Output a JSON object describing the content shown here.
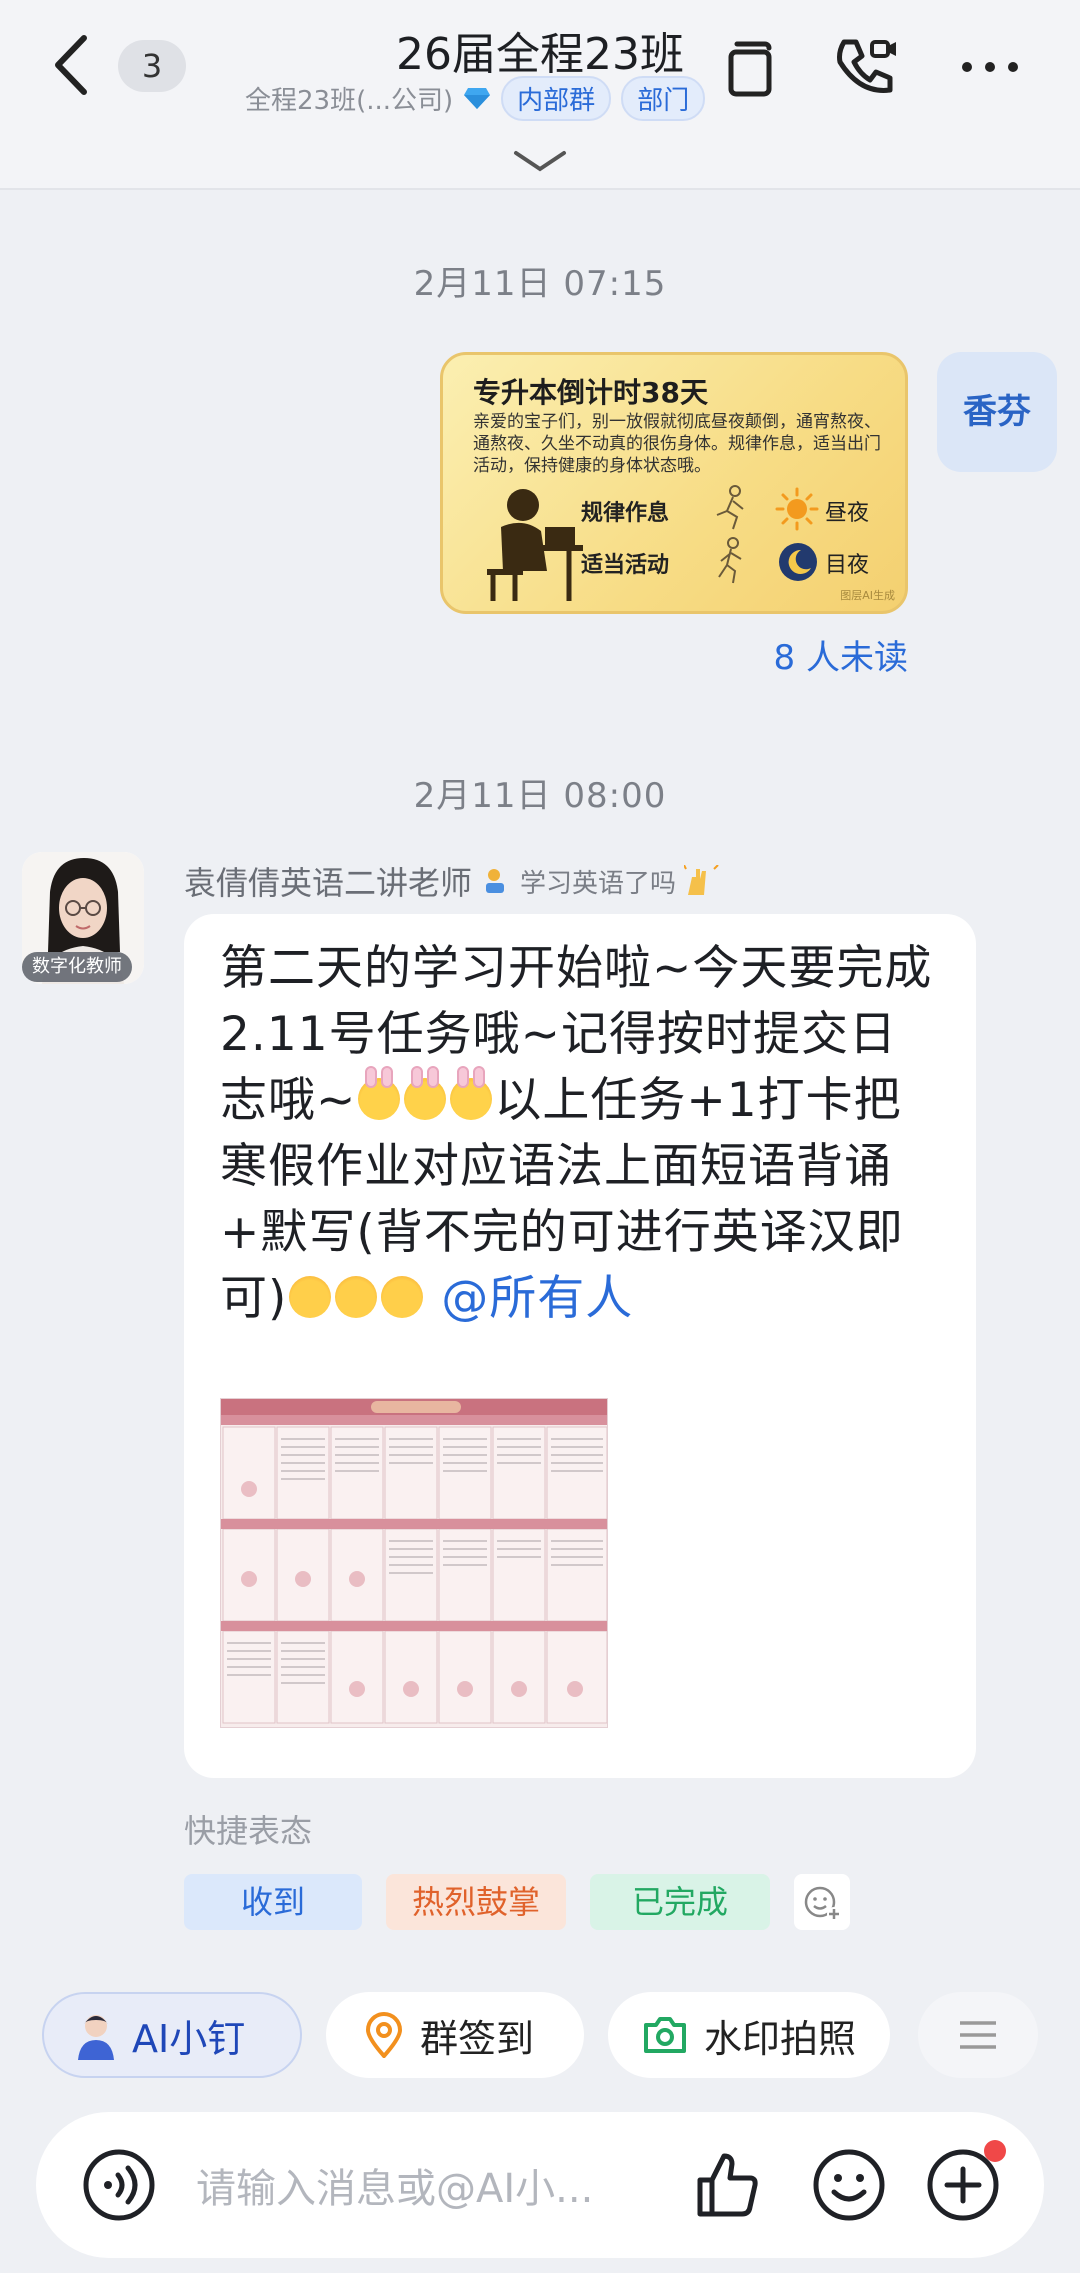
{
  "header": {
    "back_icon": "chevron-left-icon",
    "unread_count": "3",
    "title": "26届全程23班",
    "subtitle": "全程23班(...公司)",
    "tags": [
      "内部群",
      "部门"
    ],
    "icons": [
      "copy-icon",
      "video-call-icon",
      "more-icon",
      "chevron-down-icon"
    ]
  },
  "messages": [
    {
      "time": "2月11日 07:15",
      "sender": "香芬",
      "card": {
        "title": "专升本倒计时38天",
        "body": "亲爱的宝子们，别一放假就彻底昼夜颠倒，通宵熬夜、通熬夜、久坐不动真的很伤身体。规律作息，适当出门活动，保持健康的身体状态哦。",
        "row1_label": "规律作息",
        "row1_right": "昼夜",
        "row2_label": "适当活动",
        "row2_right": "目夜",
        "mark": "图层AI生成"
      },
      "unread": "8 人未读"
    },
    {
      "time": "2月11日 08:00",
      "sender_name": "袁倩倩英语二讲老师",
      "sender_status": "学习英语了吗",
      "avatar_tag": "数字化教师",
      "text_part1": "第二天的学习开始啦~今天要完成2.11号任务哦~记得按时提交日志哦~",
      "text_part2": "以上任务+1打卡把寒假作业对应语法上面短语背诵+默写(背不完的可进行英译汉即可)",
      "mention": "@所有人"
    }
  ],
  "quick_reactions": {
    "label": "快捷表态",
    "items": [
      "收到",
      "热烈鼓掌",
      "已完成"
    ]
  },
  "toolbar": {
    "ai": "AI小钉",
    "sign": "群签到",
    "photo": "水印拍照"
  },
  "input": {
    "placeholder": "请输入消息或@AI小..."
  },
  "colors": {
    "accent": "#2a6bd8",
    "background": "#eef0f4",
    "card_yellow": "#f7dc85"
  }
}
